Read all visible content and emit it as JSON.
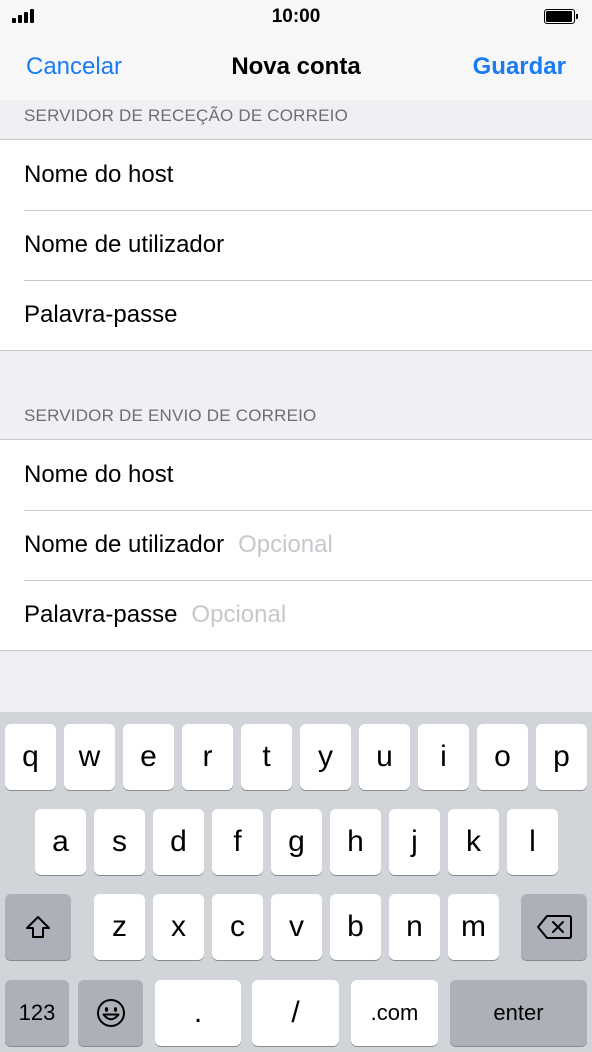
{
  "status": {
    "time": "10:00"
  },
  "nav": {
    "cancel": "Cancelar",
    "title": "Nova conta",
    "save": "Guardar"
  },
  "incoming": {
    "header": "SERVIDOR DE RECEÇÃO DE CORREIO",
    "rows": [
      {
        "label": "Nome do host",
        "placeholder": ""
      },
      {
        "label": "Nome de utilizador",
        "placeholder": ""
      },
      {
        "label": "Palavra-passe",
        "placeholder": ""
      }
    ]
  },
  "outgoing": {
    "header": "SERVIDOR DE ENVIO DE CORREIO",
    "rows": [
      {
        "label": "Nome do host",
        "placeholder": ""
      },
      {
        "label": "Nome de utilizador",
        "placeholder": "Opcional"
      },
      {
        "label": "Palavra-passe",
        "placeholder": "Opcional"
      }
    ]
  },
  "keyboard": {
    "row1": [
      "q",
      "w",
      "e",
      "r",
      "t",
      "y",
      "u",
      "i",
      "o",
      "p"
    ],
    "row2": [
      "a",
      "s",
      "d",
      "f",
      "g",
      "h",
      "j",
      "k",
      "l"
    ],
    "row3": [
      "z",
      "x",
      "c",
      "v",
      "b",
      "n",
      "m"
    ],
    "numbers": "123",
    "dot": ".",
    "slash": "/",
    "dotcom": ".com",
    "enter": "enter",
    "icons": {
      "shift": "shift-icon",
      "backspace": "backspace-icon",
      "emoji": "emoji-icon"
    }
  }
}
